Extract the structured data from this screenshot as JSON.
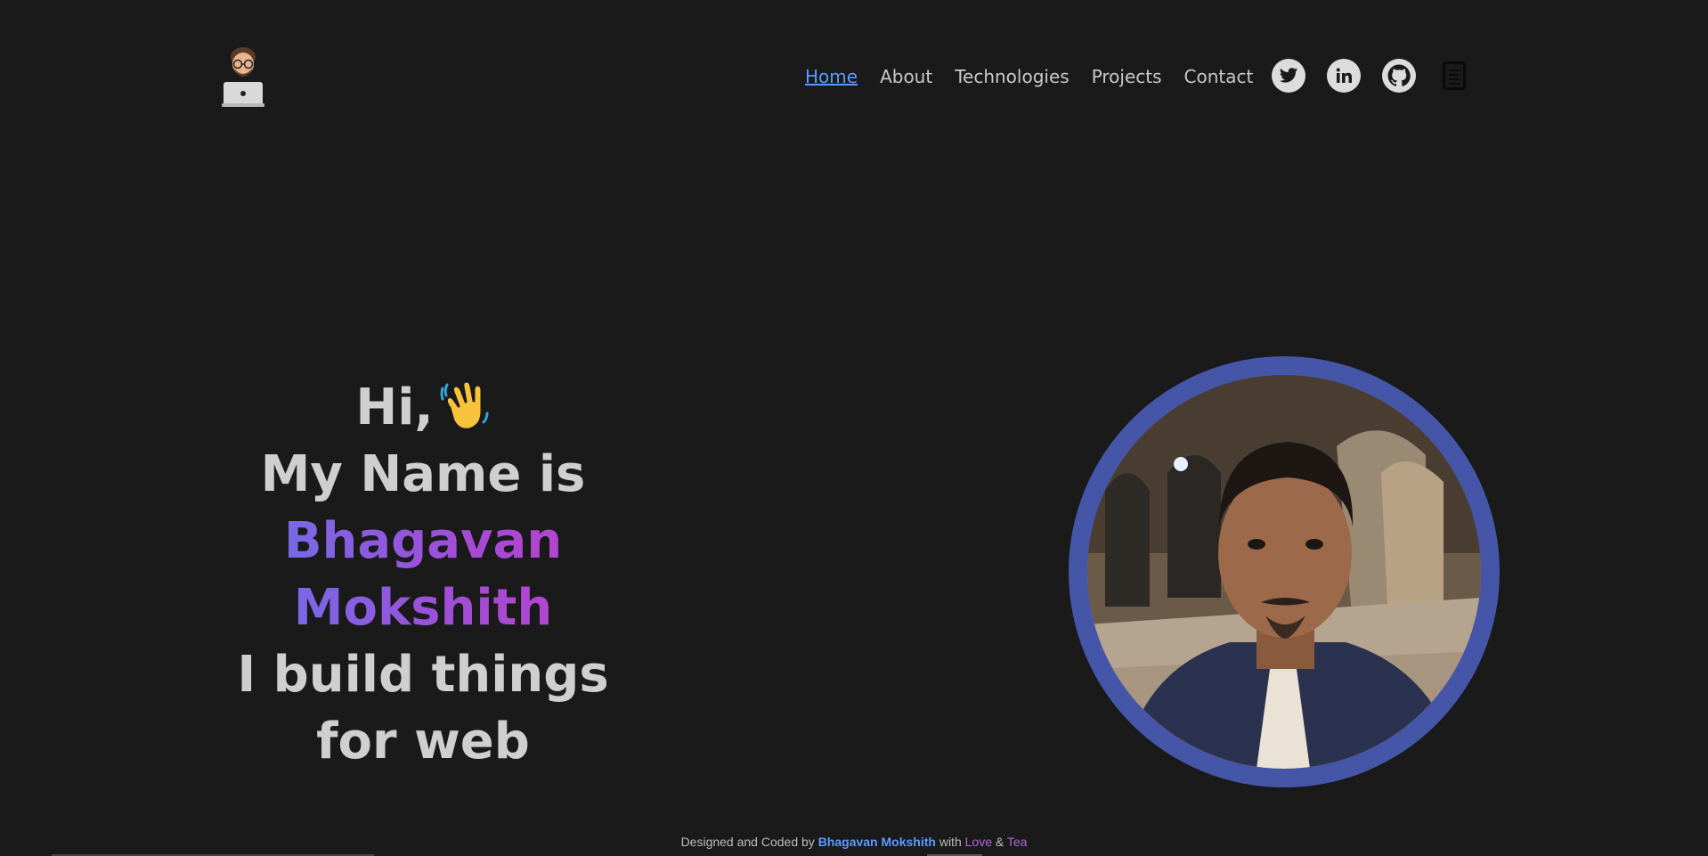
{
  "header": {
    "nav": [
      {
        "label": "Home",
        "active": true
      },
      {
        "label": "About"
      },
      {
        "label": "Technologies"
      },
      {
        "label": "Projects"
      },
      {
        "label": "Contact"
      }
    ],
    "social": [
      "twitter-icon",
      "linkedin-icon",
      "github-icon",
      "resume-icon"
    ]
  },
  "hero": {
    "greeting": "Hi,",
    "line2": "My Name is",
    "first_name": "Bhagavan",
    "last_name": "Mokshith",
    "line5": "I build things",
    "line6": "for web"
  },
  "footer": {
    "prefix": "Designed and Coded by",
    "name": "Bhagavan Mokshith",
    "with": "with",
    "love": "Love",
    "amp": "&",
    "tea": "Tea"
  },
  "colors": {
    "background": "#1a1a1a",
    "accent": "#5b9bff",
    "ring": "#4556a9",
    "gradient_start": "#5b7cf0",
    "gradient_end": "#c43ec7"
  }
}
